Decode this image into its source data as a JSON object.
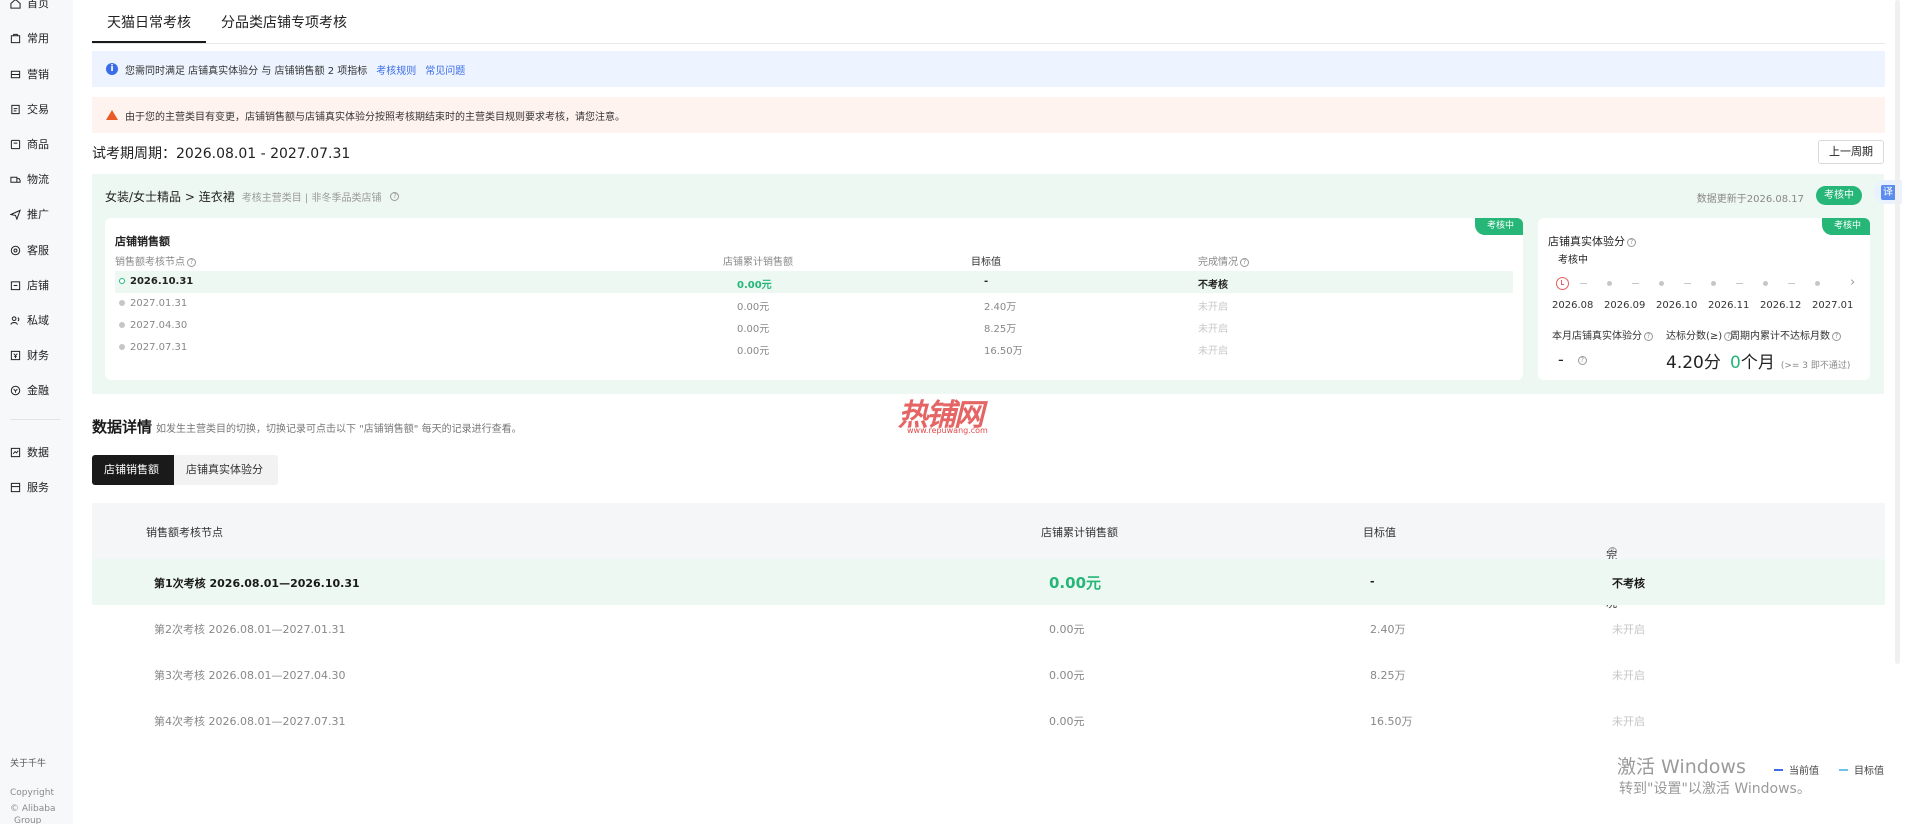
{
  "sidebar": {
    "items": [
      {
        "label": "首页",
        "icon": "home-icon"
      },
      {
        "label": "常用",
        "icon": "frequent-icon"
      },
      {
        "label": "营销",
        "icon": "marketing-icon"
      },
      {
        "label": "交易",
        "icon": "trade-icon"
      },
      {
        "label": "商品",
        "icon": "product-icon"
      },
      {
        "label": "物流",
        "icon": "logistics-icon"
      },
      {
        "label": "推广",
        "icon": "promotion-icon"
      },
      {
        "label": "客服",
        "icon": "service-icon"
      },
      {
        "label": "店铺",
        "icon": "store-icon"
      },
      {
        "label": "私域",
        "icon": "private-domain-icon"
      },
      {
        "label": "财务",
        "icon": "finance-icon"
      },
      {
        "label": "金融",
        "icon": "banking-icon"
      },
      {
        "label": "数据",
        "icon": "data-icon"
      },
      {
        "label": "服务",
        "icon": "services-icon"
      }
    ],
    "about": "关于千牛",
    "copyright": "Copyright",
    "company": "© Alibaba",
    "group": "Group"
  },
  "tabs": [
    "天猫日常考核",
    "分品类店铺专项考核"
  ],
  "info_notice": {
    "text": "您需同时满足 店铺真实体验分 与 店铺销售额 2 项指标",
    "link1": "考核规则",
    "link2": "常见问题"
  },
  "warn_notice": {
    "text": "由于您的主营类目有变更，店铺销售额与店铺真实体验分按照考核期结束时的主营类目规则要求考核，请您注意。"
  },
  "period": "试考期周期：2026.08.01 - 2027.07.31",
  "prev_button": "上一周期",
  "panel": {
    "category": "女装/女士精品 > 连衣裙",
    "category_sub": "考核主营类目 | 非冬季品类店铺",
    "update": "数据更新于2026.08.17",
    "status": "考核中"
  },
  "sales_card": {
    "title": "店铺销售额",
    "corner": "考核中",
    "headers": [
      "销售额考核节点",
      "店铺累计销售额",
      "目标值",
      "完成情况"
    ],
    "rows": [
      {
        "node": "2026.10.31",
        "sales": "0.00元",
        "target": "-",
        "status": "不考核"
      },
      {
        "node": "2027.01.31",
        "sales": "0.00元",
        "target": "2.40万",
        "status": "未开启"
      },
      {
        "node": "2027.04.30",
        "sales": "0.00元",
        "target": "8.25万",
        "status": "未开启"
      },
      {
        "node": "2027.07.31",
        "sales": "0.00元",
        "target": "16.50万",
        "status": "未开启"
      }
    ]
  },
  "score_card": {
    "title": "店铺真实体验分",
    "corner": "考核中",
    "state": "考核中",
    "months": [
      "2026.08",
      "2026.09",
      "2026.10",
      "2026.11",
      "2026.12",
      "2027.01"
    ],
    "label_score": "本月店铺真实体验分",
    "label_target": "达标分数(≥)",
    "label_months": "周期内累计不达标月数",
    "score_value": "-",
    "target_value": "4.20分",
    "months_value": "0",
    "months_unit": "个月",
    "months_note": "(>= 3 即不通过)"
  },
  "detail": {
    "title": "数据详情",
    "note": "如发生主营类目的切换，切换记录可点击以下 \"店铺销售额\" 每天的记录进行查看。",
    "seg_on": "店铺销售额",
    "seg_off": "店铺真实体验分"
  },
  "table": {
    "headers": [
      "销售额考核节点",
      "店铺累计销售额",
      "目标值",
      "完成情况"
    ],
    "rows": [
      {
        "node": "第1次考核 2026.08.01—2026.10.31",
        "sales": "0.00元",
        "target": "-",
        "status": "不考核"
      },
      {
        "node": "第2次考核 2026.08.01—2027.01.31",
        "sales": "0.00元",
        "target": "2.40万",
        "status": "未开启"
      },
      {
        "node": "第3次考核 2026.08.01—2027.04.30",
        "sales": "0.00元",
        "target": "8.25万",
        "status": "未开启"
      },
      {
        "node": "第4次考核 2026.08.01—2027.07.31",
        "sales": "0.00元",
        "target": "16.50万",
        "status": "未开启"
      }
    ]
  },
  "windows": {
    "line1": "激活 Windows",
    "line2": "转到\"设置\"以激活 Windows。"
  },
  "legend": {
    "current": "当前值",
    "target": "目标值",
    "current_color": "#3b6de8",
    "target_color": "#6fc2e8"
  },
  "float_tab": "译",
  "watermark": {
    "text": "热铺网",
    "url": "www.repuwang.com"
  },
  "colors": {
    "accent": "#25b678",
    "link": "#3b6de8",
    "warn": "#ea5a26"
  }
}
